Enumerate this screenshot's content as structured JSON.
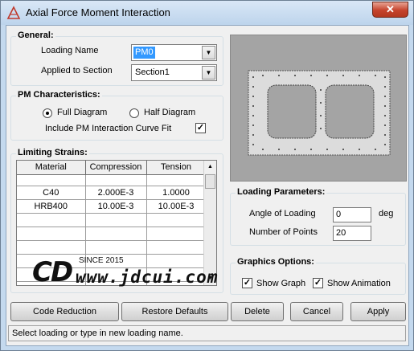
{
  "window": {
    "title": "Axial Force Moment Interaction",
    "close_label": "✕"
  },
  "general": {
    "label": "General:",
    "loading_name_label": "Loading Name",
    "loading_name_value": "PM0",
    "applied_to_label": "Applied to Section",
    "applied_to_value": "Section1"
  },
  "pm": {
    "label": "PM Characteristics:",
    "full_diagram": "Full Diagram",
    "half_diagram": "Half Diagram",
    "full_selected": true,
    "include_label": "Include PM Interaction Curve Fit",
    "include_checked": true
  },
  "limiting": {
    "label": "Limiting Strains:",
    "columns": [
      "Material",
      "Compression",
      "Tension"
    ],
    "rows": [
      [
        "C40",
        "2.000E-3",
        "1.0000"
      ],
      [
        "HRB400",
        "10.00E-3",
        "10.00E-3"
      ]
    ]
  },
  "watermark": {
    "since": "SINCE 2015",
    "url": "www.jdcui.com"
  },
  "loading_params": {
    "label": "Loading Parameters:",
    "angle_label": "Angle of Loading",
    "angle_value": "0",
    "angle_unit": "deg",
    "points_label": "Number of Points",
    "points_value": "20"
  },
  "graphics": {
    "label": "Graphics Options:",
    "show_graph": "Show Graph",
    "show_animation": "Show Animation",
    "show_graph_checked": true,
    "show_animation_checked": true
  },
  "buttons": {
    "code_reduction": "Code Reduction",
    "restore_defaults": "Restore Defaults",
    "delete": "Delete",
    "cancel": "Cancel",
    "apply": "Apply"
  },
  "status": "Select loading or type in new loading name.",
  "colors": {
    "selection": "#3399ff",
    "preview_bg": "#a4a4a4",
    "title_bar": "#c4d9ee"
  }
}
